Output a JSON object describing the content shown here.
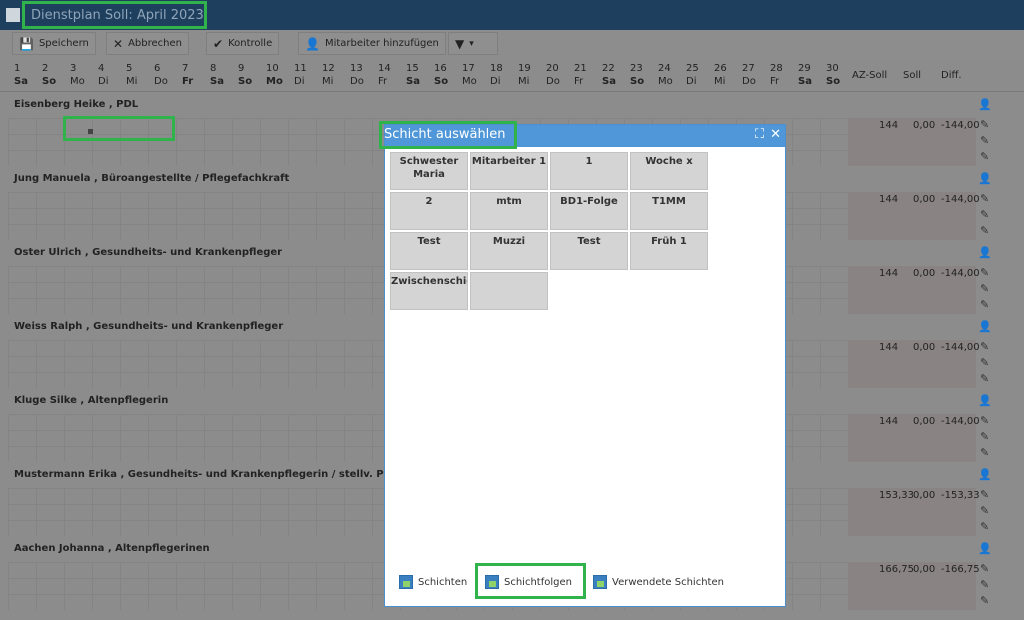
{
  "window": {
    "title": "Dienstplan Soll: April 2023"
  },
  "toolbar": {
    "save": "Speichern",
    "cancel": "Abbrechen",
    "check": "Kontrolle",
    "add_employee": "Mitarbeiter hinzufügen"
  },
  "days": [
    {
      "n": "1",
      "w": "Sa",
      "b": true
    },
    {
      "n": "2",
      "w": "So",
      "b": true
    },
    {
      "n": "3",
      "w": "Mo",
      "b": false
    },
    {
      "n": "4",
      "w": "Di",
      "b": false
    },
    {
      "n": "5",
      "w": "Mi",
      "b": false
    },
    {
      "n": "6",
      "w": "Do",
      "b": false
    },
    {
      "n": "7",
      "w": "Fr",
      "b": true
    },
    {
      "n": "8",
      "w": "Sa",
      "b": true
    },
    {
      "n": "9",
      "w": "So",
      "b": true
    },
    {
      "n": "10",
      "w": "Mo",
      "b": true
    },
    {
      "n": "11",
      "w": "Di",
      "b": false
    },
    {
      "n": "12",
      "w": "Mi",
      "b": false
    },
    {
      "n": "13",
      "w": "Do",
      "b": false
    },
    {
      "n": "14",
      "w": "Fr",
      "b": false
    },
    {
      "n": "15",
      "w": "Sa",
      "b": true
    },
    {
      "n": "16",
      "w": "So",
      "b": true
    },
    {
      "n": "17",
      "w": "Mo",
      "b": false
    },
    {
      "n": "18",
      "w": "Di",
      "b": false
    },
    {
      "n": "19",
      "w": "Mi",
      "b": false
    },
    {
      "n": "20",
      "w": "Do",
      "b": false
    },
    {
      "n": "21",
      "w": "Fr",
      "b": false
    },
    {
      "n": "22",
      "w": "Sa",
      "b": true
    },
    {
      "n": "23",
      "w": "So",
      "b": true
    },
    {
      "n": "24",
      "w": "Mo",
      "b": false
    },
    {
      "n": "25",
      "w": "Di",
      "b": false
    },
    {
      "n": "26",
      "w": "Mi",
      "b": false
    },
    {
      "n": "27",
      "w": "Do",
      "b": false
    },
    {
      "n": "28",
      "w": "Fr",
      "b": false
    },
    {
      "n": "29",
      "w": "Sa",
      "b": true
    },
    {
      "n": "30",
      "w": "So",
      "b": true
    }
  ],
  "summary_headers": {
    "az_soll": "AZ-Soll",
    "soll": "Soll",
    "diff": "Diff."
  },
  "employees": [
    {
      "name": "Eisenberg Heike , PDL",
      "az": "144",
      "soll": "0,00",
      "diff": "-144,00"
    },
    {
      "name": "Jung Manuela , Büroangestellte / Pflegefachkraft",
      "az": "144",
      "soll": "0,00",
      "diff": "-144,00"
    },
    {
      "name": "Oster Ulrich , Gesundheits- und Krankenpfleger",
      "az": "144",
      "soll": "0,00",
      "diff": "-144,00"
    },
    {
      "name": "Weiss Ralph , Gesundheits- und Krankenpfleger",
      "az": "144",
      "soll": "0,00",
      "diff": "-144,00"
    },
    {
      "name": "Kluge Silke , Altenpflegerin",
      "az": "144",
      "soll": "0,00",
      "diff": "-144,00"
    },
    {
      "name": "Mustermann Erika , Gesundheits- und Krankenpflegerin / stellv. PDL",
      "az": "153,33",
      "soll": "0,00",
      "diff": "-153,33"
    },
    {
      "name": "Aachen Johanna , Altenpflegerinen",
      "az": "166,75",
      "soll": "0,00",
      "diff": "-166,75"
    }
  ],
  "modal": {
    "title": "Schicht auswählen",
    "tiles": [
      "Schwester Maria",
      "Mitarbeiter 1",
      "1",
      "Woche x",
      "2",
      "mtm",
      "BD1-Folge",
      "T1MM",
      "Test",
      "Muzzi",
      "Test",
      "Früh 1",
      "Zwischenschicht",
      ""
    ],
    "tabs": [
      "Schichten",
      "Schichtfolgen",
      "Verwendete Schichten"
    ]
  }
}
